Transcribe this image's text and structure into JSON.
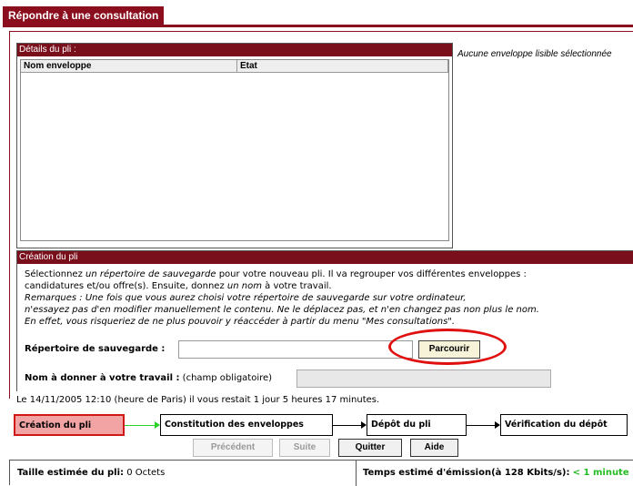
{
  "window": {
    "title": "Répondre à une consultation"
  },
  "details": {
    "header": "Détails du pli :",
    "columns": [
      "Nom enveloppe",
      "Etat"
    ],
    "side_note": "Aucune enveloppe lisible sélectionnée"
  },
  "creation": {
    "header": "Création du pli",
    "intro_1a": "Sélectionnez ",
    "intro_1b": "un répertoire de sauvegarde",
    "intro_1c": " pour votre nouveau pli. Il va regrouper vos différentes enveloppes :",
    "intro_2a": "candidatures et/ou offre(s). Ensuite, donnez ",
    "intro_2b": "un nom",
    "intro_2c": " à votre travail.",
    "remark_1": "Remarques : Une fois que vous aurez choisi votre répertoire de sauvegarde sur votre ordinateur,",
    "remark_2": "n'essayez pas d'en modifier manuellement le contenu. Ne le déplacez pas, et n'en changez pas non plus le nom.",
    "remark_3": "En effet, vous risqueriez de ne plus pouvoir y réaccéder à partir du menu \"Mes consultations\".",
    "dir_label": "Répertoire de sauvegarde :",
    "dir_value": "",
    "browse_label": "Parcourir",
    "name_label": "Nom à donner à votre travail :",
    "name_hint": " (champ obligatoire)",
    "name_value": "",
    "deadline": "Le 14/11/2005 12:10 (heure de Paris) il vous restait 1 jour 5 heures 17 minutes."
  },
  "steps": [
    {
      "label": "Création du pli",
      "active": true
    },
    {
      "label": "Constitution des enveloppes",
      "active": false
    },
    {
      "label": "Dépôt du pli",
      "active": false
    },
    {
      "label": "Vérification du dépôt",
      "active": false
    }
  ],
  "buttons": {
    "previous": "Précédent",
    "next": "Suite",
    "quit": "Quitter",
    "help": "Aide"
  },
  "status": {
    "size_label": "Taille estimée du pli:",
    "size_value": "0 Octets",
    "time_label": "Temps estimé d'émission(à 128 Kbits/s):",
    "time_value": "< 1 minute"
  },
  "colors": {
    "accent": "#8b0e1e",
    "highlight": "#e01010",
    "active_step_fill": "#f2a3a3",
    "time_value": "#22bb22"
  }
}
